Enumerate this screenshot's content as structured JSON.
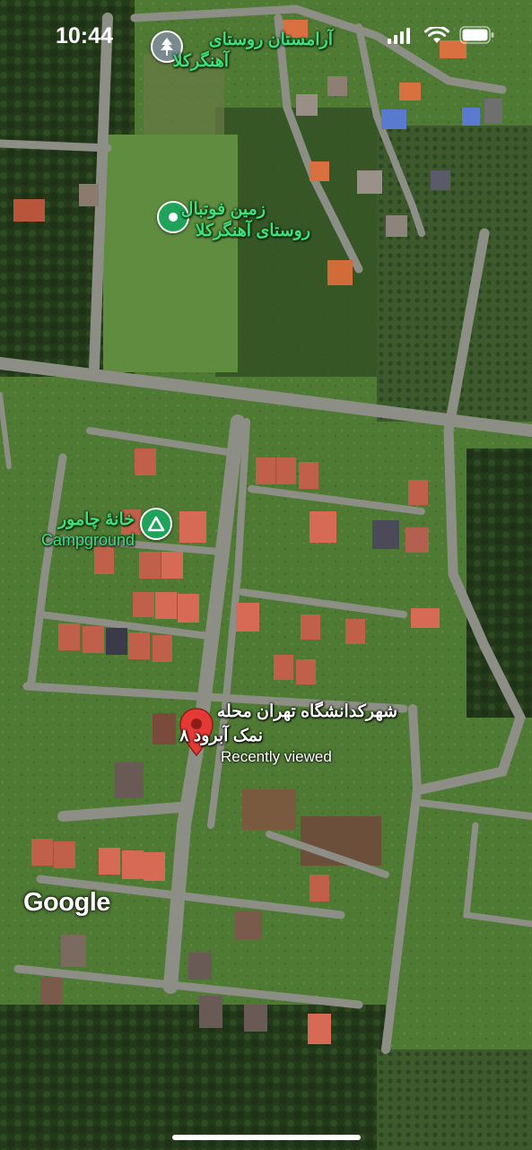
{
  "status_bar": {
    "time": "10:44",
    "icons": [
      "signal-icon",
      "wifi-icon",
      "battery-icon"
    ]
  },
  "places": [
    {
      "id": "cemetery",
      "icon": "cemetery-icon",
      "lines": [
        "آرامستان روستای",
        "آهنگرکلا"
      ]
    },
    {
      "id": "football",
      "icon": "place-marker-icon",
      "lines": [
        "زمین فوتبال",
        "روستای آهنگرکلا"
      ]
    },
    {
      "id": "campground",
      "icon": "campground-icon",
      "lines": [
        "خانهٔ چامور",
        "Campground"
      ]
    }
  ],
  "selected_place": {
    "icon": "red-pin-icon",
    "lines": [
      "شهرکدانشگاه تهران محله",
      "۸ نمک آبرود"
    ],
    "subtitle": "Recently viewed"
  },
  "attribution": "Google",
  "colors": {
    "label_green": "#3ee07a",
    "pin_green": "#1fa35a",
    "selected_pin": "#e53935"
  }
}
